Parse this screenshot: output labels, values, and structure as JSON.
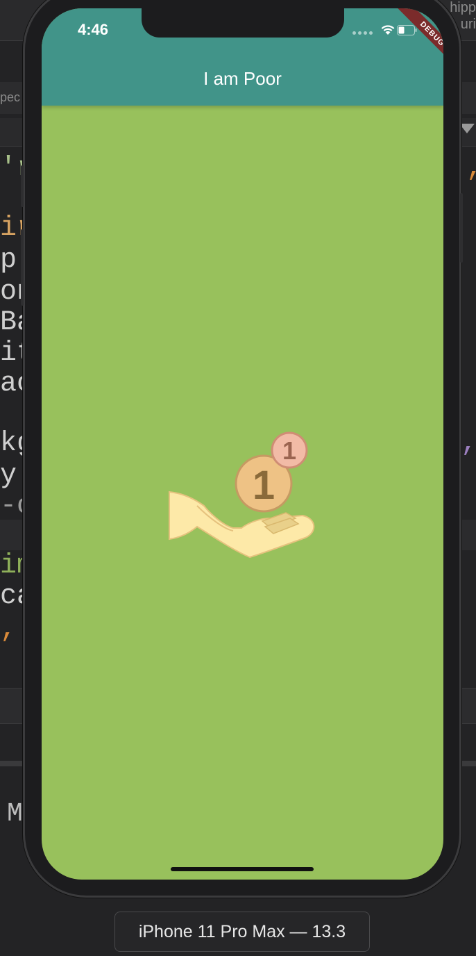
{
  "ide": {
    "top_text_1": "hipp",
    "top_text_2": "uri",
    "tab_text": "pec",
    "code_lines": [
      {
        "text": "'r",
        "color": "#a8c08a"
      },
      {
        "text": "ir",
        "color": "#d9a462"
      },
      {
        "text": "p",
        "color": "#cfcfcf"
      },
      {
        "text": "on",
        "color": "#cfcfcf"
      },
      {
        "text": "Ba",
        "color": "#cfcfcf"
      },
      {
        "text": "it",
        "color": "#cfcfcf"
      },
      {
        "text": "ac",
        "color": "#cfcfcf"
      },
      {
        "text": "kg",
        "color": "#cfcfcf"
      },
      {
        "text": "y:",
        "color": "#cfcfcf"
      },
      {
        "text": "-c",
        "color": "#9a9a9a"
      },
      {
        "text": "im",
        "color": "#8fb05a"
      },
      {
        "text": "ca",
        "color": "#cfcfcf"
      },
      {
        "text": ",",
        "color": "#d98a3a"
      }
    ],
    "right_fragments": [
      {
        "text": "',",
        "color": "#d98a3a"
      },
      {
        "text": "n,",
        "color": "#9b7fbf"
      }
    ],
    "bottom_text": "M"
  },
  "status_bar": {
    "time": "4:46"
  },
  "app_bar": {
    "title": "I am Poor",
    "color": "#419489"
  },
  "debug_banner": "DEBUG",
  "body": {
    "background_color": "#98c15c",
    "image": "hand-receiving-coins",
    "coin_large_label": "1",
    "coin_small_label": "1"
  },
  "device_label": "iPhone 11 Pro Max — 13.3"
}
